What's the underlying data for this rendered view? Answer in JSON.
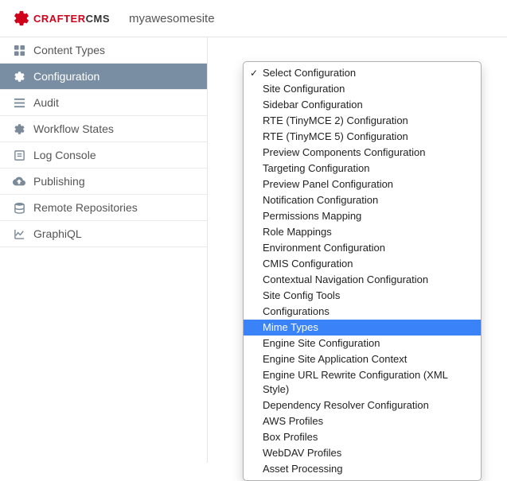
{
  "header": {
    "logo_crafter": "CRAFTER",
    "logo_cms": "CMS",
    "site_name": "myawesomesite"
  },
  "sidebar": {
    "items": [
      {
        "label": "Content Types",
        "icon": "grid-icon",
        "active": false
      },
      {
        "label": "Configuration",
        "icon": "gear-icon",
        "active": true
      },
      {
        "label": "Audit",
        "icon": "list-icon",
        "active": false
      },
      {
        "label": "Workflow States",
        "icon": "gear-icon",
        "active": false
      },
      {
        "label": "Log Console",
        "icon": "log-icon",
        "active": false
      },
      {
        "label": "Publishing",
        "icon": "cloud-icon",
        "active": false
      },
      {
        "label": "Remote Repositories",
        "icon": "database-icon",
        "active": false
      },
      {
        "label": "GraphiQL",
        "icon": "chart-icon",
        "active": false
      }
    ]
  },
  "dropdown": {
    "items": [
      {
        "label": "Select Configuration",
        "selected": true,
        "highlighted": false
      },
      {
        "label": "Site Configuration",
        "selected": false,
        "highlighted": false
      },
      {
        "label": "Sidebar Configuration",
        "selected": false,
        "highlighted": false
      },
      {
        "label": "RTE (TinyMCE 2) Configuration",
        "selected": false,
        "highlighted": false
      },
      {
        "label": "RTE (TinyMCE 5) Configuration",
        "selected": false,
        "highlighted": false
      },
      {
        "label": "Preview Components Configuration",
        "selected": false,
        "highlighted": false
      },
      {
        "label": "Targeting Configuration",
        "selected": false,
        "highlighted": false
      },
      {
        "label": "Preview Panel Configuration",
        "selected": false,
        "highlighted": false
      },
      {
        "label": "Notification Configuration",
        "selected": false,
        "highlighted": false
      },
      {
        "label": "Permissions Mapping",
        "selected": false,
        "highlighted": false
      },
      {
        "label": "Role Mappings",
        "selected": false,
        "highlighted": false
      },
      {
        "label": "Environment Configuration",
        "selected": false,
        "highlighted": false
      },
      {
        "label": "CMIS Configuration",
        "selected": false,
        "highlighted": false
      },
      {
        "label": "Contextual Navigation Configuration",
        "selected": false,
        "highlighted": false
      },
      {
        "label": "Site Config Tools",
        "selected": false,
        "highlighted": false
      },
      {
        "label": "Configurations",
        "selected": false,
        "highlighted": false
      },
      {
        "label": "Mime Types",
        "selected": false,
        "highlighted": true
      },
      {
        "label": "Engine Site Configuration",
        "selected": false,
        "highlighted": false
      },
      {
        "label": "Engine Site Application Context",
        "selected": false,
        "highlighted": false
      },
      {
        "label": "Engine URL Rewrite Configuration (XML Style)",
        "selected": false,
        "highlighted": false
      },
      {
        "label": "Dependency Resolver Configuration",
        "selected": false,
        "highlighted": false
      },
      {
        "label": "AWS Profiles",
        "selected": false,
        "highlighted": false
      },
      {
        "label": "Box Profiles",
        "selected": false,
        "highlighted": false
      },
      {
        "label": "WebDAV Profiles",
        "selected": false,
        "highlighted": false
      },
      {
        "label": "Asset Processing",
        "selected": false,
        "highlighted": false
      }
    ]
  }
}
